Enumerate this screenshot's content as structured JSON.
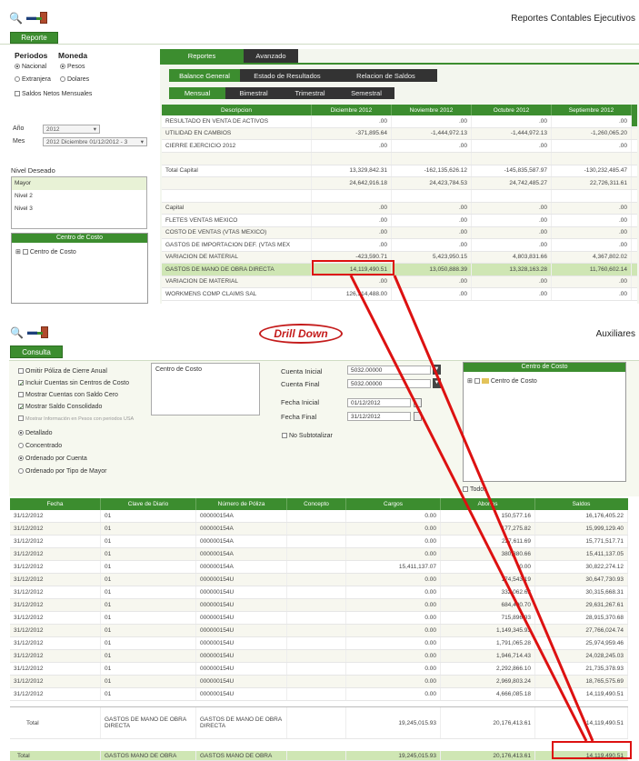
{
  "top": {
    "title": "Reportes Contables Ejecutivos",
    "action_button": "Reporte",
    "periodos_label": "Periodos",
    "moneda_label": "Moneda",
    "periodo_options": [
      "Nacional",
      "Extranjera"
    ],
    "moneda_options": [
      "Pesos",
      "Dolares"
    ],
    "saldos_netos": "Saldos Netos Mensuales",
    "anio_label": "Año",
    "anio_value": "2012",
    "mes_label": "Mes",
    "mes_value": "2012 Diciembre 01/12/2012 - 3",
    "nivel_label": "Nivel Deseado",
    "niveles": [
      "Mayor",
      "Nivel 2",
      "Nivel 3"
    ],
    "centro_header": "Centro de Costo",
    "centro_item": "Centro de Costo",
    "tabs_main": [
      "Reportes",
      "Avanzado"
    ],
    "tabs_report": [
      "Balance General",
      "Estado de Resultados",
      "Relacion de Saldos"
    ],
    "tabs_period": [
      "Mensual",
      "Bimestral",
      "Trimestral",
      "Semestral"
    ],
    "columns": [
      "Descripcion",
      "Diciembre 2012",
      "Noviembre 2012",
      "Octubre 2012",
      "Septiembre 2012"
    ],
    "rows": [
      [
        "RESULTADO EN VENTA DE ACTIVOS",
        ".00",
        ".00",
        ".00",
        ".00"
      ],
      [
        "UTILIDAD EN CAMBIOS",
        "-371,895.64",
        "-1,444,972.13",
        "-1,444,972.13",
        "-1,260,065.20"
      ],
      [
        "CIERRE EJERCICIO 2012",
        ".00",
        ".00",
        ".00",
        ".00"
      ],
      [
        "",
        "",
        "",
        "",
        ""
      ],
      [
        "Total Capital",
        "13,329,842.31",
        "-162,135,626.12",
        "-145,835,587.97",
        "-130,232,485.47"
      ],
      [
        "",
        "24,642,916.18",
        "24,423,784.53",
        "24,742,485.27",
        "22,726,311.61"
      ],
      [
        "",
        "",
        "",
        "",
        ""
      ],
      [
        "Capital",
        ".00",
        ".00",
        ".00",
        ".00"
      ],
      [
        "FLETES VENTAS MEXICO",
        ".00",
        ".00",
        ".00",
        ".00"
      ],
      [
        "COSTO DE VENTAS (VTAS MEXICO)",
        ".00",
        ".00",
        ".00",
        ".00"
      ],
      [
        "GASTOS DE IMPORTACION DEF. (VTAS MEX",
        ".00",
        ".00",
        ".00",
        ".00"
      ],
      [
        "VARIACION DE MATERIAL",
        "-423,590.71",
        "5,423,950.15",
        "4,803,831.66",
        "4,367,802.02"
      ],
      [
        "GASTOS DE MANO DE OBRA DIRECTA",
        "14,119,490.51",
        "13,050,888.39",
        "13,328,163.28",
        "11,760,602.14"
      ],
      [
        "VARIACION DE MATERIAL",
        ".00",
        ".00",
        ".00",
        ".00"
      ],
      [
        "WORKMENS COMP CLAIMS SAL",
        "126,314,488.00",
        ".00",
        ".00",
        ".00"
      ]
    ]
  },
  "drill_label": "Drill Down",
  "bottom": {
    "title": "Auxiliares",
    "action_button": "Consulta",
    "options": [
      {
        "label": "Omitir Póliza de Cierre Anual",
        "checked": false
      },
      {
        "label": "Incluir Cuentas sin Centros de Costo",
        "checked": true
      },
      {
        "label": "Mostrar Cuentas con Saldo Cero",
        "checked": false
      },
      {
        "label": "Mostrar Saldo Consolidado",
        "checked": true
      },
      {
        "label": "Mostrar Información en Pesos con periodos USA",
        "checked": false
      }
    ],
    "radios": [
      {
        "label": "Detallado",
        "on": true
      },
      {
        "label": "Concentrado",
        "on": false
      },
      {
        "label": "Ordenado por Cuenta",
        "on": true
      },
      {
        "label": "Ordenado por Tipo de Mayor",
        "on": false
      }
    ],
    "centro_costo_list": "Centro de Costo",
    "cuenta_inicial_label": "Cuenta Inicial",
    "cuenta_inicial": "5032.00000",
    "cuenta_final_label": "Cuenta Final",
    "cuenta_final": "5032.00000",
    "fecha_inicial_label": "Fecha Inicial",
    "fecha_inicial": "01/12/2012",
    "fecha_final_label": "Fecha Final",
    "fecha_final": "31/12/2012",
    "no_subtotalizar": "No Subtotalizar",
    "tree_header": "Centro de Costo",
    "tree_item": "Centro de Costo",
    "todos": "Todos",
    "columns": [
      "Fecha",
      "Clave de Diario",
      "Número de Póliza",
      "Concepto",
      "Cargos",
      "Abonos",
      "Saldos"
    ],
    "rows": [
      [
        "31/12/2012",
        "01",
        "000000154A",
        "",
        "0.00",
        "150,577.16",
        "16,176,405.22"
      ],
      [
        "31/12/2012",
        "01",
        "000000154A",
        "",
        "0.00",
        "177,275.82",
        "15,999,129.40"
      ],
      [
        "31/12/2012",
        "01",
        "000000154A",
        "",
        "0.00",
        "227,611.69",
        "15,771,517.71"
      ],
      [
        "31/12/2012",
        "01",
        "000000154A",
        "",
        "0.00",
        "380,380.66",
        "15,411,137.05"
      ],
      [
        "31/12/2012",
        "01",
        "000000154A",
        "",
        "15,411,137.07",
        "0.00",
        "30,822,274.12"
      ],
      [
        "31/12/2012",
        "01",
        "000000154U",
        "",
        "0.00",
        "174,543.19",
        "30,647,730.93"
      ],
      [
        "31/12/2012",
        "01",
        "000000154U",
        "",
        "0.00",
        "332,062.62",
        "30,315,668.31"
      ],
      [
        "31/12/2012",
        "01",
        "000000154U",
        "",
        "0.00",
        "684,400.70",
        "29,631,267.61"
      ],
      [
        "31/12/2012",
        "01",
        "000000154U",
        "",
        "0.00",
        "715,896.93",
        "28,915,370.68"
      ],
      [
        "31/12/2012",
        "01",
        "000000154U",
        "",
        "0.00",
        "1,149,345.93",
        "27,766,024.74"
      ],
      [
        "31/12/2012",
        "01",
        "000000154U",
        "",
        "0.00",
        "1,791,065.28",
        "25,974,959.46"
      ],
      [
        "31/12/2012",
        "01",
        "000000154U",
        "",
        "0.00",
        "1,946,714.43",
        "24,028,245.03"
      ],
      [
        "31/12/2012",
        "01",
        "000000154U",
        "",
        "0.00",
        "2,292,866.10",
        "21,735,378.93"
      ],
      [
        "31/12/2012",
        "01",
        "000000154U",
        "",
        "0.00",
        "2,969,803.24",
        "18,765,575.69"
      ],
      [
        "31/12/2012",
        "01",
        "000000154U",
        "",
        "0.00",
        "4,666,085.18",
        "14,119,490.51"
      ]
    ],
    "total_row": [
      "Total",
      "GASTOS DE MANO DE OBRA DIRECTA",
      "GASTOS DE MANO DE OBRA DIRECTA",
      "",
      "19,245,015.93",
      "20,176,413.61",
      "14,119,490.51"
    ],
    "total_row2": [
      "Total",
      "GASTOS MANO DE OBRA",
      "GASTOS MANO DE OBRA",
      "",
      "19,245,015.93",
      "20,176,413.61",
      "14,119,490.51"
    ]
  },
  "colors": {
    "green": "#3c8d2f",
    "dark": "#333333",
    "red": "#d11111",
    "highlight": "#cfe6b4"
  }
}
